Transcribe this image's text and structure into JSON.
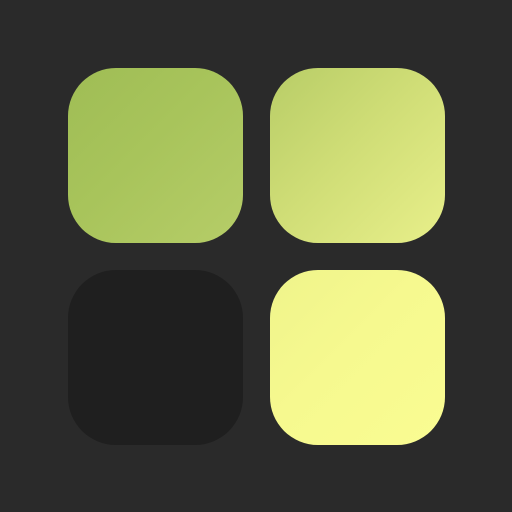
{
  "icon": {
    "name": "four-square-grid-icon",
    "background_color": "#2a2a2a",
    "tiles": [
      {
        "name": "top-left-tile",
        "color": "#a8c45b"
      },
      {
        "name": "top-right-tile",
        "color": "#d7e27c"
      },
      {
        "name": "bottom-left-tile",
        "color": "#1f1f1f"
      },
      {
        "name": "bottom-right-tile",
        "color": "#f6f98f"
      }
    ]
  }
}
